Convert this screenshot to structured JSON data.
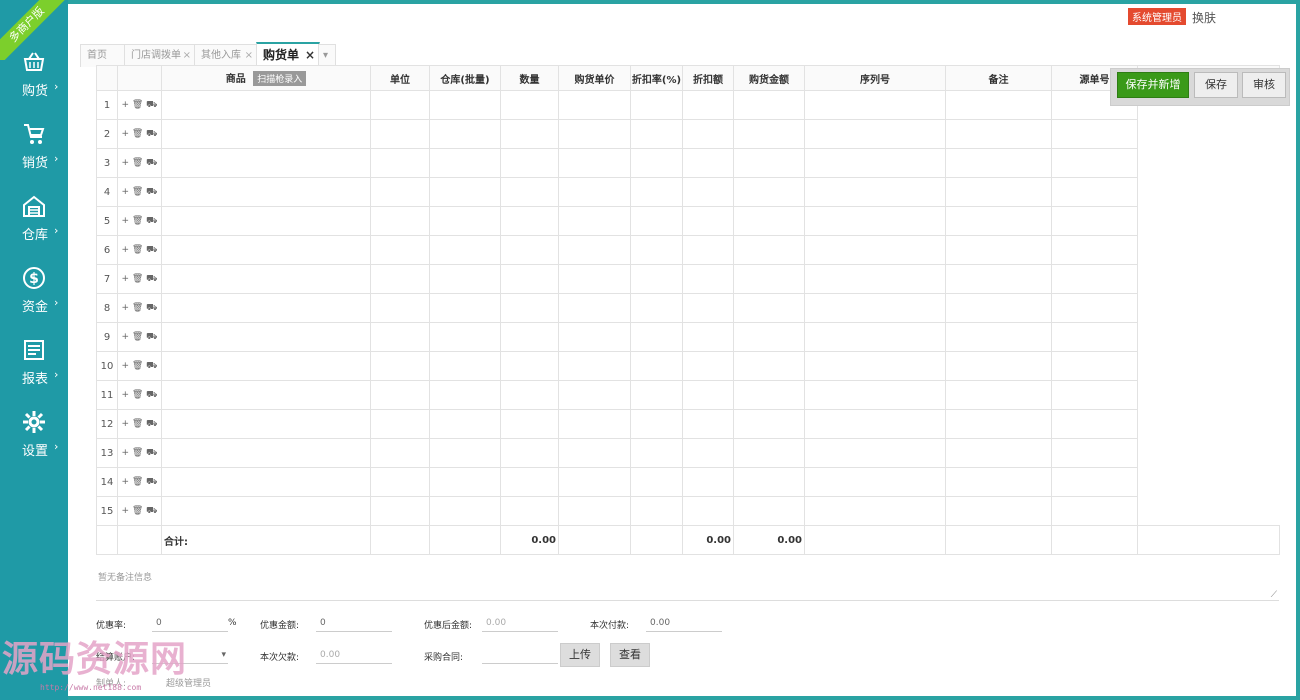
{
  "corner_badge": "多商户版",
  "nav": [
    {
      "label": "购货",
      "icon": "basket-icon"
    },
    {
      "label": "销货",
      "icon": "cart-icon"
    },
    {
      "label": "仓库",
      "icon": "warehouse-icon"
    },
    {
      "label": "资金",
      "icon": "dollar-icon"
    },
    {
      "label": "报表",
      "icon": "report-icon"
    },
    {
      "label": "设置",
      "icon": "gear-icon"
    }
  ],
  "nav_arrow": "›",
  "topbar": {
    "admin": "系统管理员",
    "skin": "换肤"
  },
  "tabs": [
    {
      "label": "首页"
    },
    {
      "label": "门店调拨单",
      "close": "×"
    },
    {
      "label": "其他入库",
      "close": "×"
    },
    {
      "label": "购货单",
      "close": "×"
    }
  ],
  "tab_more": "▾",
  "toolbar": {
    "save_new": "保存并新增",
    "save": "保存",
    "audit": "审核"
  },
  "columns": [
    "商品",
    "单位",
    "仓库(批量)",
    "数量",
    "购货单价",
    "折扣率(%)",
    "折扣额",
    "购货金额",
    "序列号",
    "备注",
    "源单号"
  ],
  "scan_button": "扫描枪录入",
  "row_ops": "+ 🗑 ⛟",
  "rows": [
    "1",
    "2",
    "3",
    "4",
    "5",
    "6",
    "7",
    "8",
    "9",
    "10",
    "11",
    "12",
    "13",
    "14",
    "15"
  ],
  "totals": {
    "label": "合计:",
    "qty": "0.00",
    "discount": "0.00",
    "amount": "0.00"
  },
  "note_placeholder": "暂无备注信息",
  "form": {
    "discount_rate_label": "优惠率:",
    "discount_rate": "0",
    "percent": "%",
    "discount_amount_label": "优惠金额:",
    "discount_amount": "0",
    "after_discount_label": "优惠后金额:",
    "after_discount": "0.00",
    "payment_label": "本次付款:",
    "payment": "0.00",
    "account_label": "结算账户:",
    "debt_label": "本次欠款:",
    "debt": "0.00",
    "contract_label": "采购合同:",
    "upload": "上传",
    "view": "查看",
    "creator_label": "制单人:",
    "creator": "超级管理员"
  },
  "watermark": {
    "title": "源码资源网",
    "url": "http://www.net188.com"
  },
  "colors": {
    "sidebar": "#1f9aa6",
    "accent_green": "#3a9a19",
    "admin_badge": "#e44a2f"
  }
}
